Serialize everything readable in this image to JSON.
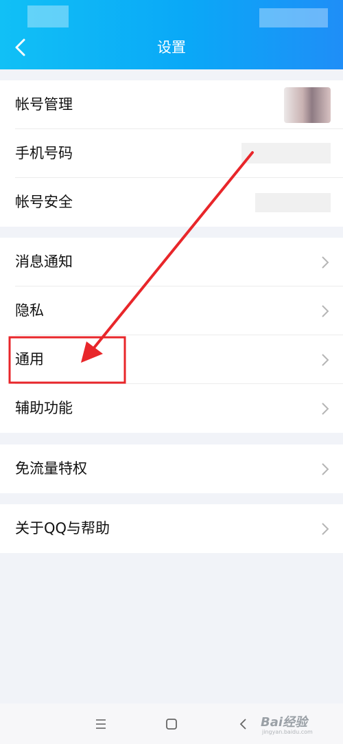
{
  "header": {
    "title": "设置"
  },
  "groups": [
    {
      "items": [
        {
          "label": "帐号管理"
        },
        {
          "label": "手机号码"
        },
        {
          "label": "帐号安全"
        }
      ]
    },
    {
      "items": [
        {
          "label": "消息通知"
        },
        {
          "label": "隐私"
        },
        {
          "label": "通用"
        },
        {
          "label": "辅助功能"
        }
      ]
    },
    {
      "items": [
        {
          "label": "免流量特权"
        }
      ]
    },
    {
      "items": [
        {
          "label": "关于QQ与帮助"
        }
      ]
    }
  ],
  "watermark": {
    "brand": "Bai经验",
    "url": "jingyan.baidu.com"
  },
  "colors": {
    "header_start": "#11c0f6",
    "header_end": "#1f8ef7",
    "annotation": "#e8262a",
    "background": "#f1f3f8"
  },
  "icons": {
    "back": "chevron-left-icon",
    "row_arrow": "chevron-right-icon",
    "nav": [
      "menu-icon",
      "home-square-icon",
      "back-triangle-icon"
    ]
  }
}
